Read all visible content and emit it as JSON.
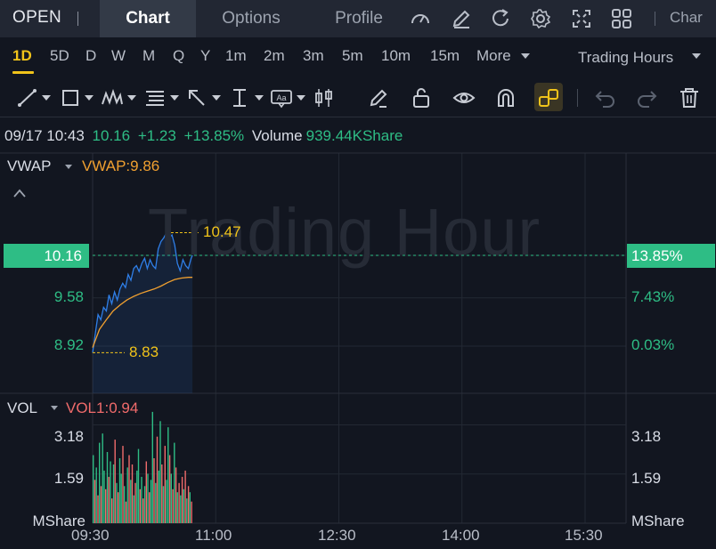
{
  "header": {
    "ticker": "OPEN",
    "tabs": [
      {
        "label": "Chart",
        "active": true
      },
      {
        "label": "Options",
        "active": false
      },
      {
        "label": "Profile",
        "active": false
      }
    ],
    "icons": [
      "speedometer-icon",
      "edit-icon",
      "refresh-icon",
      "settings-icon",
      "fullscreen-icon",
      "grid-layout-icon"
    ],
    "truncated_label": "Char"
  },
  "periods": {
    "items": [
      "1D",
      "5D",
      "D",
      "W",
      "M",
      "Q",
      "Y",
      "1m",
      "2m",
      "3m",
      "5m",
      "10m",
      "15m"
    ],
    "active": "1D",
    "more_label": "More",
    "trading_hours_label": "Trading Hours"
  },
  "tools": [
    "line-tool-icon",
    "rectangle-tool-icon",
    "pattern-tool-icon",
    "fibonacci-tool-icon",
    "arrow-tool-icon",
    "measure-tool-icon",
    "text-tool-icon",
    "candle-tool-icon",
    "pencil-icon",
    "unlock-icon",
    "eye-icon",
    "magnet-icon",
    "link-icon",
    "undo-icon",
    "redo-icon",
    "trash-icon"
  ],
  "quote": {
    "datetime": "09/17 10:43",
    "price": "10.16",
    "change": "+1.23",
    "change_pct": "+13.85%",
    "volume_label": "Volume",
    "volume": "939.44KShare"
  },
  "main_panel": {
    "indicator": "VWAP",
    "indicator_value": "VWAP:9.86",
    "price_axis": [
      "10.16",
      "9.58",
      "8.92"
    ],
    "pct_axis": [
      "13.85%",
      "7.43%",
      "0.03%"
    ],
    "high_label": "10.47",
    "low_label": "8.83",
    "watermark": "Trading Hour"
  },
  "volume_panel": {
    "indicator": "VOL",
    "indicator_value": "VOL1:0.94",
    "left_axis": [
      "3.18",
      "1.59",
      "MShare"
    ],
    "right_axis": [
      "3.18",
      "1.59",
      "MShare"
    ]
  },
  "x_axis": [
    "09:30",
    "11:00",
    "12:30",
    "14:00",
    "15:30"
  ],
  "colors": {
    "background": "#121620",
    "up": "#2ebd85",
    "down": "#f06b6b",
    "price_line": "#2f7fe8",
    "vwap_line": "#f0a030",
    "accent": "#f0c31a"
  },
  "chart_data": [
    {
      "type": "line",
      "x_label_ticks": [
        "09:30",
        "11:00",
        "12:30",
        "14:00",
        "15:30"
      ],
      "y_ticks": [
        8.92,
        9.58,
        10.16
      ],
      "prev_close": 8.93,
      "ylim": [
        8.83,
        10.47
      ],
      "series": [
        {
          "name": "Price",
          "x": [
            "09:30",
            "09:32",
            "09:34",
            "09:36",
            "09:38",
            "09:40",
            "09:42",
            "09:44",
            "09:46",
            "09:48",
            "09:50",
            "09:52",
            "09:54",
            "09:56",
            "09:58",
            "10:00",
            "10:02",
            "10:04",
            "10:06",
            "10:08",
            "10:10",
            "10:12",
            "10:14",
            "10:16",
            "10:18",
            "10:20",
            "10:22",
            "10:24",
            "10:26",
            "10:28",
            "10:30",
            "10:32",
            "10:34",
            "10:36",
            "10:38",
            "10:40",
            "10:42",
            "10:43"
          ],
          "y": [
            8.83,
            9.1,
            9.35,
            9.28,
            9.45,
            9.4,
            9.62,
            9.5,
            9.66,
            9.55,
            9.7,
            9.78,
            9.72,
            9.9,
            9.82,
            9.98,
            10.02,
            9.94,
            10.05,
            10.12,
            9.98,
            10.1,
            10.02,
            9.98,
            10.25,
            10.35,
            10.4,
            10.47,
            10.4,
            10.44,
            10.3,
            10.05,
            9.95,
            10.1,
            10.02,
            9.98,
            10.12,
            10.16
          ]
        },
        {
          "name": "VWAP",
          "x": [
            "09:30",
            "09:35",
            "09:40",
            "09:45",
            "09:50",
            "09:55",
            "10:00",
            "10:05",
            "10:10",
            "10:15",
            "10:20",
            "10:25",
            "10:30",
            "10:35",
            "10:40",
            "10:43"
          ],
          "y": [
            8.9,
            9.15,
            9.28,
            9.4,
            9.48,
            9.55,
            9.6,
            9.64,
            9.67,
            9.7,
            9.74,
            9.79,
            9.83,
            9.85,
            9.86,
            9.86
          ]
        }
      ]
    },
    {
      "type": "bar",
      "title": "VOL",
      "ylabel": "MShare",
      "y_ticks": [
        1.59,
        3.18
      ],
      "ylim": [
        0,
        4.2
      ],
      "x_range": [
        "09:30",
        "10:43"
      ],
      "values": [
        2.2,
        1.4,
        1.8,
        0.9,
        2.6,
        1.2,
        2.9,
        1.7,
        1.1,
        2.3,
        1.5,
        2.0,
        0.8,
        1.9,
        2.7,
        1.3,
        1.0,
        2.1,
        1.6,
        2.5,
        1.2,
        0.7,
        1.8,
        2.2,
        1.4,
        1.9,
        0.9,
        1.3,
        1.7,
        2.4,
        1.1,
        1.5,
        0.8,
        1.2,
        2.0,
        1.6,
        1.0,
        1.4,
        3.6,
        2.1,
        1.3,
        2.8,
        1.7,
        3.3,
        1.9,
        1.2,
        2.5,
        1.4,
        3.1,
        2.2,
        1.6,
        1.1,
        2.6,
        1.8,
        1.0,
        1.3,
        0.9,
        1.5,
        1.1,
        1.7,
        0.8,
        1.2,
        1.0,
        0.7
      ],
      "up": [
        true,
        false,
        true,
        false,
        true,
        false,
        true,
        true,
        false,
        true,
        false,
        true,
        false,
        true,
        false,
        true,
        false,
        true,
        true,
        false,
        true,
        false,
        true,
        false,
        true,
        false,
        true,
        false,
        true,
        true,
        false,
        true,
        false,
        true,
        false,
        true,
        false,
        true,
        true,
        false,
        true,
        false,
        true,
        true,
        false,
        true,
        false,
        true,
        true,
        false,
        true,
        false,
        true,
        false,
        true,
        false,
        true,
        false,
        true,
        false,
        true,
        false,
        true,
        false
      ]
    }
  ]
}
